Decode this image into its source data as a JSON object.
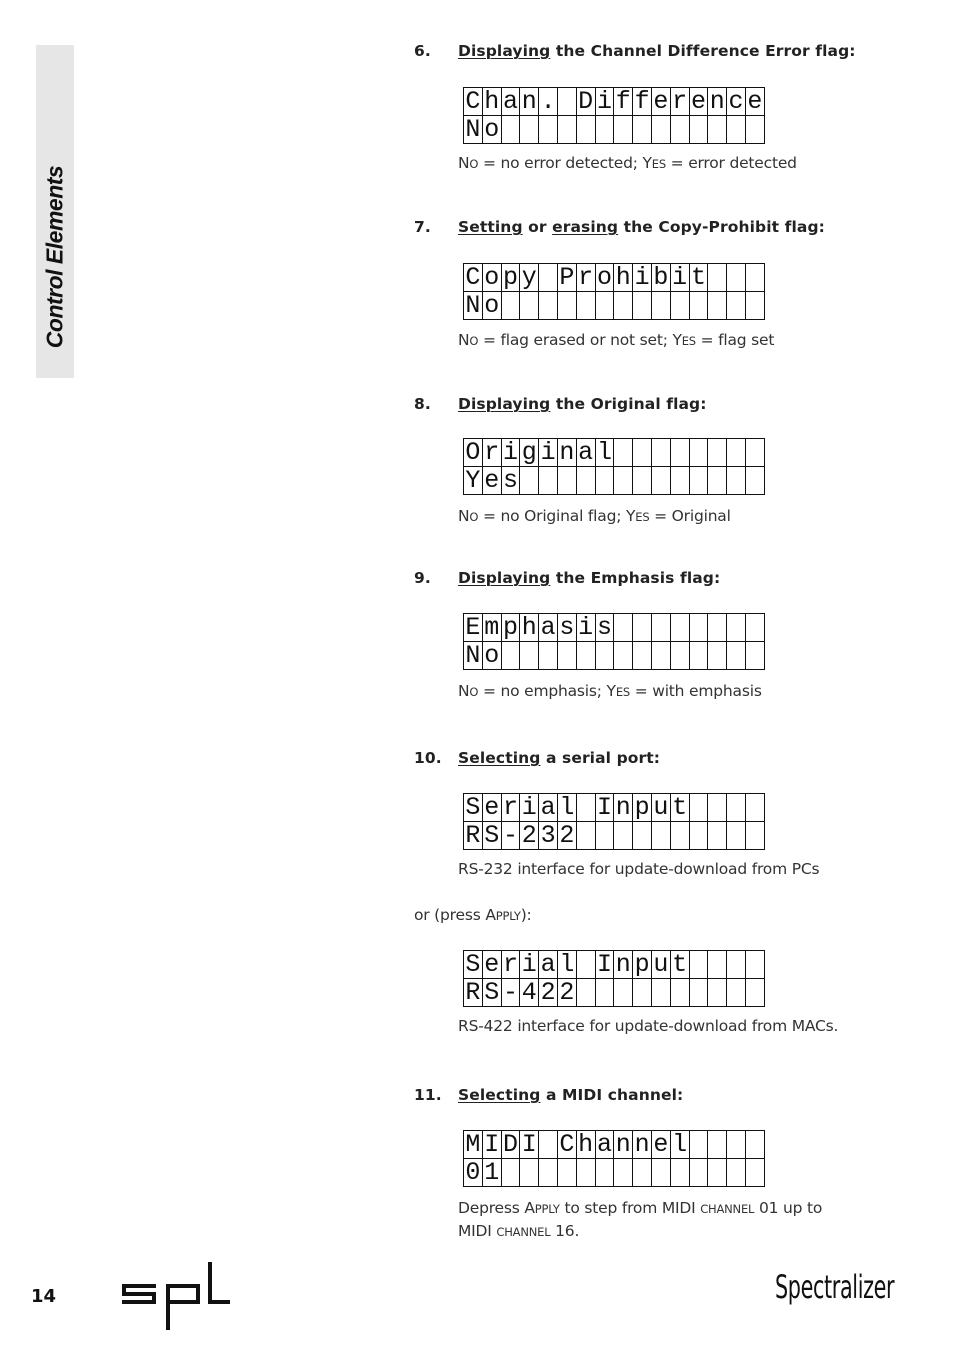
{
  "sidebar": {
    "section_title": "Control Elements"
  },
  "steps": [
    {
      "number": "6.",
      "title_parts": [
        {
          "text": "Displaying",
          "underline": true
        },
        {
          "text": " the Channel Difference Error flag:",
          "underline": false
        }
      ],
      "lcd": {
        "line1": "Chan. Difference",
        "line2": "No"
      },
      "caption": [
        {
          "t": "N"
        },
        {
          "t": "O",
          "sc": true
        },
        {
          "t": " = no error detected; Y"
        },
        {
          "t": "ES",
          "sc": true
        },
        {
          "t": " = error detected"
        }
      ]
    },
    {
      "number": "7.",
      "title_parts": [
        {
          "text": "Setting",
          "underline": true
        },
        {
          "text": " or ",
          "underline": false
        },
        {
          "text": "erasing",
          "underline": true
        },
        {
          "text": " the Copy-Prohibit flag:",
          "underline": false
        }
      ],
      "lcd": {
        "line1": "Copy Prohibit",
        "line2": "No"
      },
      "caption": [
        {
          "t": "N"
        },
        {
          "t": "O",
          "sc": true
        },
        {
          "t": " = flag erased or not set; Y"
        },
        {
          "t": "ES",
          "sc": true
        },
        {
          "t": " = flag set"
        }
      ]
    },
    {
      "number": "8.",
      "title_parts": [
        {
          "text": "Displaying",
          "underline": true
        },
        {
          "text": " the Original flag:",
          "underline": false
        }
      ],
      "lcd": {
        "line1": "Original",
        "line2": "Yes"
      },
      "caption": [
        {
          "t": "N"
        },
        {
          "t": "O",
          "sc": true
        },
        {
          "t": " = no Original flag; Y"
        },
        {
          "t": "ES",
          "sc": true
        },
        {
          "t": " = Original"
        }
      ]
    },
    {
      "number": "9.",
      "title_parts": [
        {
          "text": "Displaying",
          "underline": true
        },
        {
          "text": " the Emphasis flag:",
          "underline": false
        }
      ],
      "lcd": {
        "line1": "Emphasis",
        "line2": "No"
      },
      "caption": [
        {
          "t": "N"
        },
        {
          "t": "O",
          "sc": true
        },
        {
          "t": " = no emphasis; Y"
        },
        {
          "t": "ES",
          "sc": true
        },
        {
          "t": " = with emphasis"
        }
      ]
    },
    {
      "number": "10.",
      "title_parts": [
        {
          "text": "Selecting",
          "underline": true
        },
        {
          "text": " a serial port:",
          "underline": false
        }
      ],
      "lcd": {
        "line1": "Serial Input",
        "line2": "RS-232"
      },
      "caption": [
        {
          "t": "RS-232 interface for update-download from PCs"
        }
      ],
      "alt_intro": [
        {
          "t": "or (press A"
        },
        {
          "t": "PPLY",
          "sc": true
        },
        {
          "t": "):"
        }
      ],
      "alt_lcd": {
        "line1": "Serial Input",
        "line2": "RS-422"
      },
      "alt_caption": [
        {
          "t": "RS-422 interface for update-download from MACs."
        }
      ]
    },
    {
      "number": "11.",
      "title_parts": [
        {
          "text": "Selecting",
          "underline": true
        },
        {
          "text": " a MIDI channel:",
          "underline": false
        }
      ],
      "lcd": {
        "line1": "MIDI Channel",
        "line2": "01"
      },
      "caption": [
        {
          "t": "Depress A"
        },
        {
          "t": "PPLY",
          "sc": true
        },
        {
          "t": " to step from MIDI "
        },
        {
          "t": "CHANNEL",
          "sc": true
        },
        {
          "t": " 01 up to MIDI "
        },
        {
          "t": "CHANNEL",
          "sc": true
        },
        {
          "t": " 16."
        }
      ]
    }
  ],
  "lcd_columns": 16,
  "footer": {
    "page_number": "14",
    "logo_text": "spl",
    "product_name": "Spectralizer"
  }
}
